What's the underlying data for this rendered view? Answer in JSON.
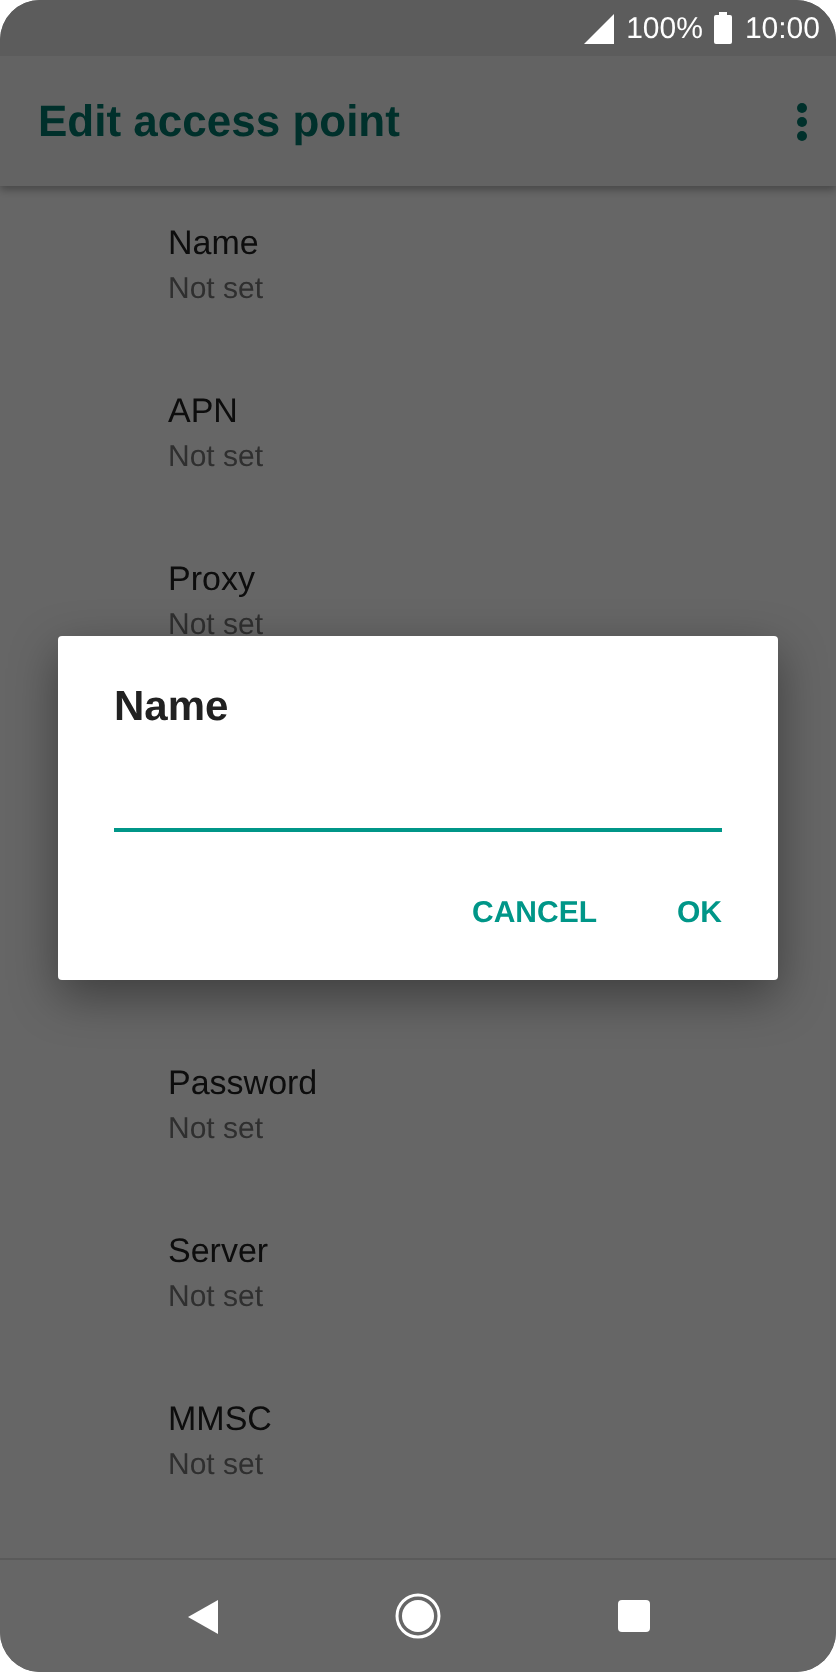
{
  "status_bar": {
    "battery": "100%",
    "time": "10:00"
  },
  "app_bar": {
    "title": "Edit access point"
  },
  "settings": [
    {
      "kind": "row",
      "title": "Name",
      "value": "Not set"
    },
    {
      "kind": "row",
      "title": "APN",
      "value": "Not set"
    },
    {
      "kind": "row",
      "title": "Proxy",
      "value": "Not set"
    },
    {
      "kind": "row",
      "title": "Password",
      "value": "Not set"
    },
    {
      "kind": "row",
      "title": "Server",
      "value": "Not set"
    },
    {
      "kind": "row",
      "title": "MMSC",
      "value": "Not set"
    }
  ],
  "dialog": {
    "title": "Name",
    "buttons": [
      "CANCEL",
      "OK"
    ]
  }
}
